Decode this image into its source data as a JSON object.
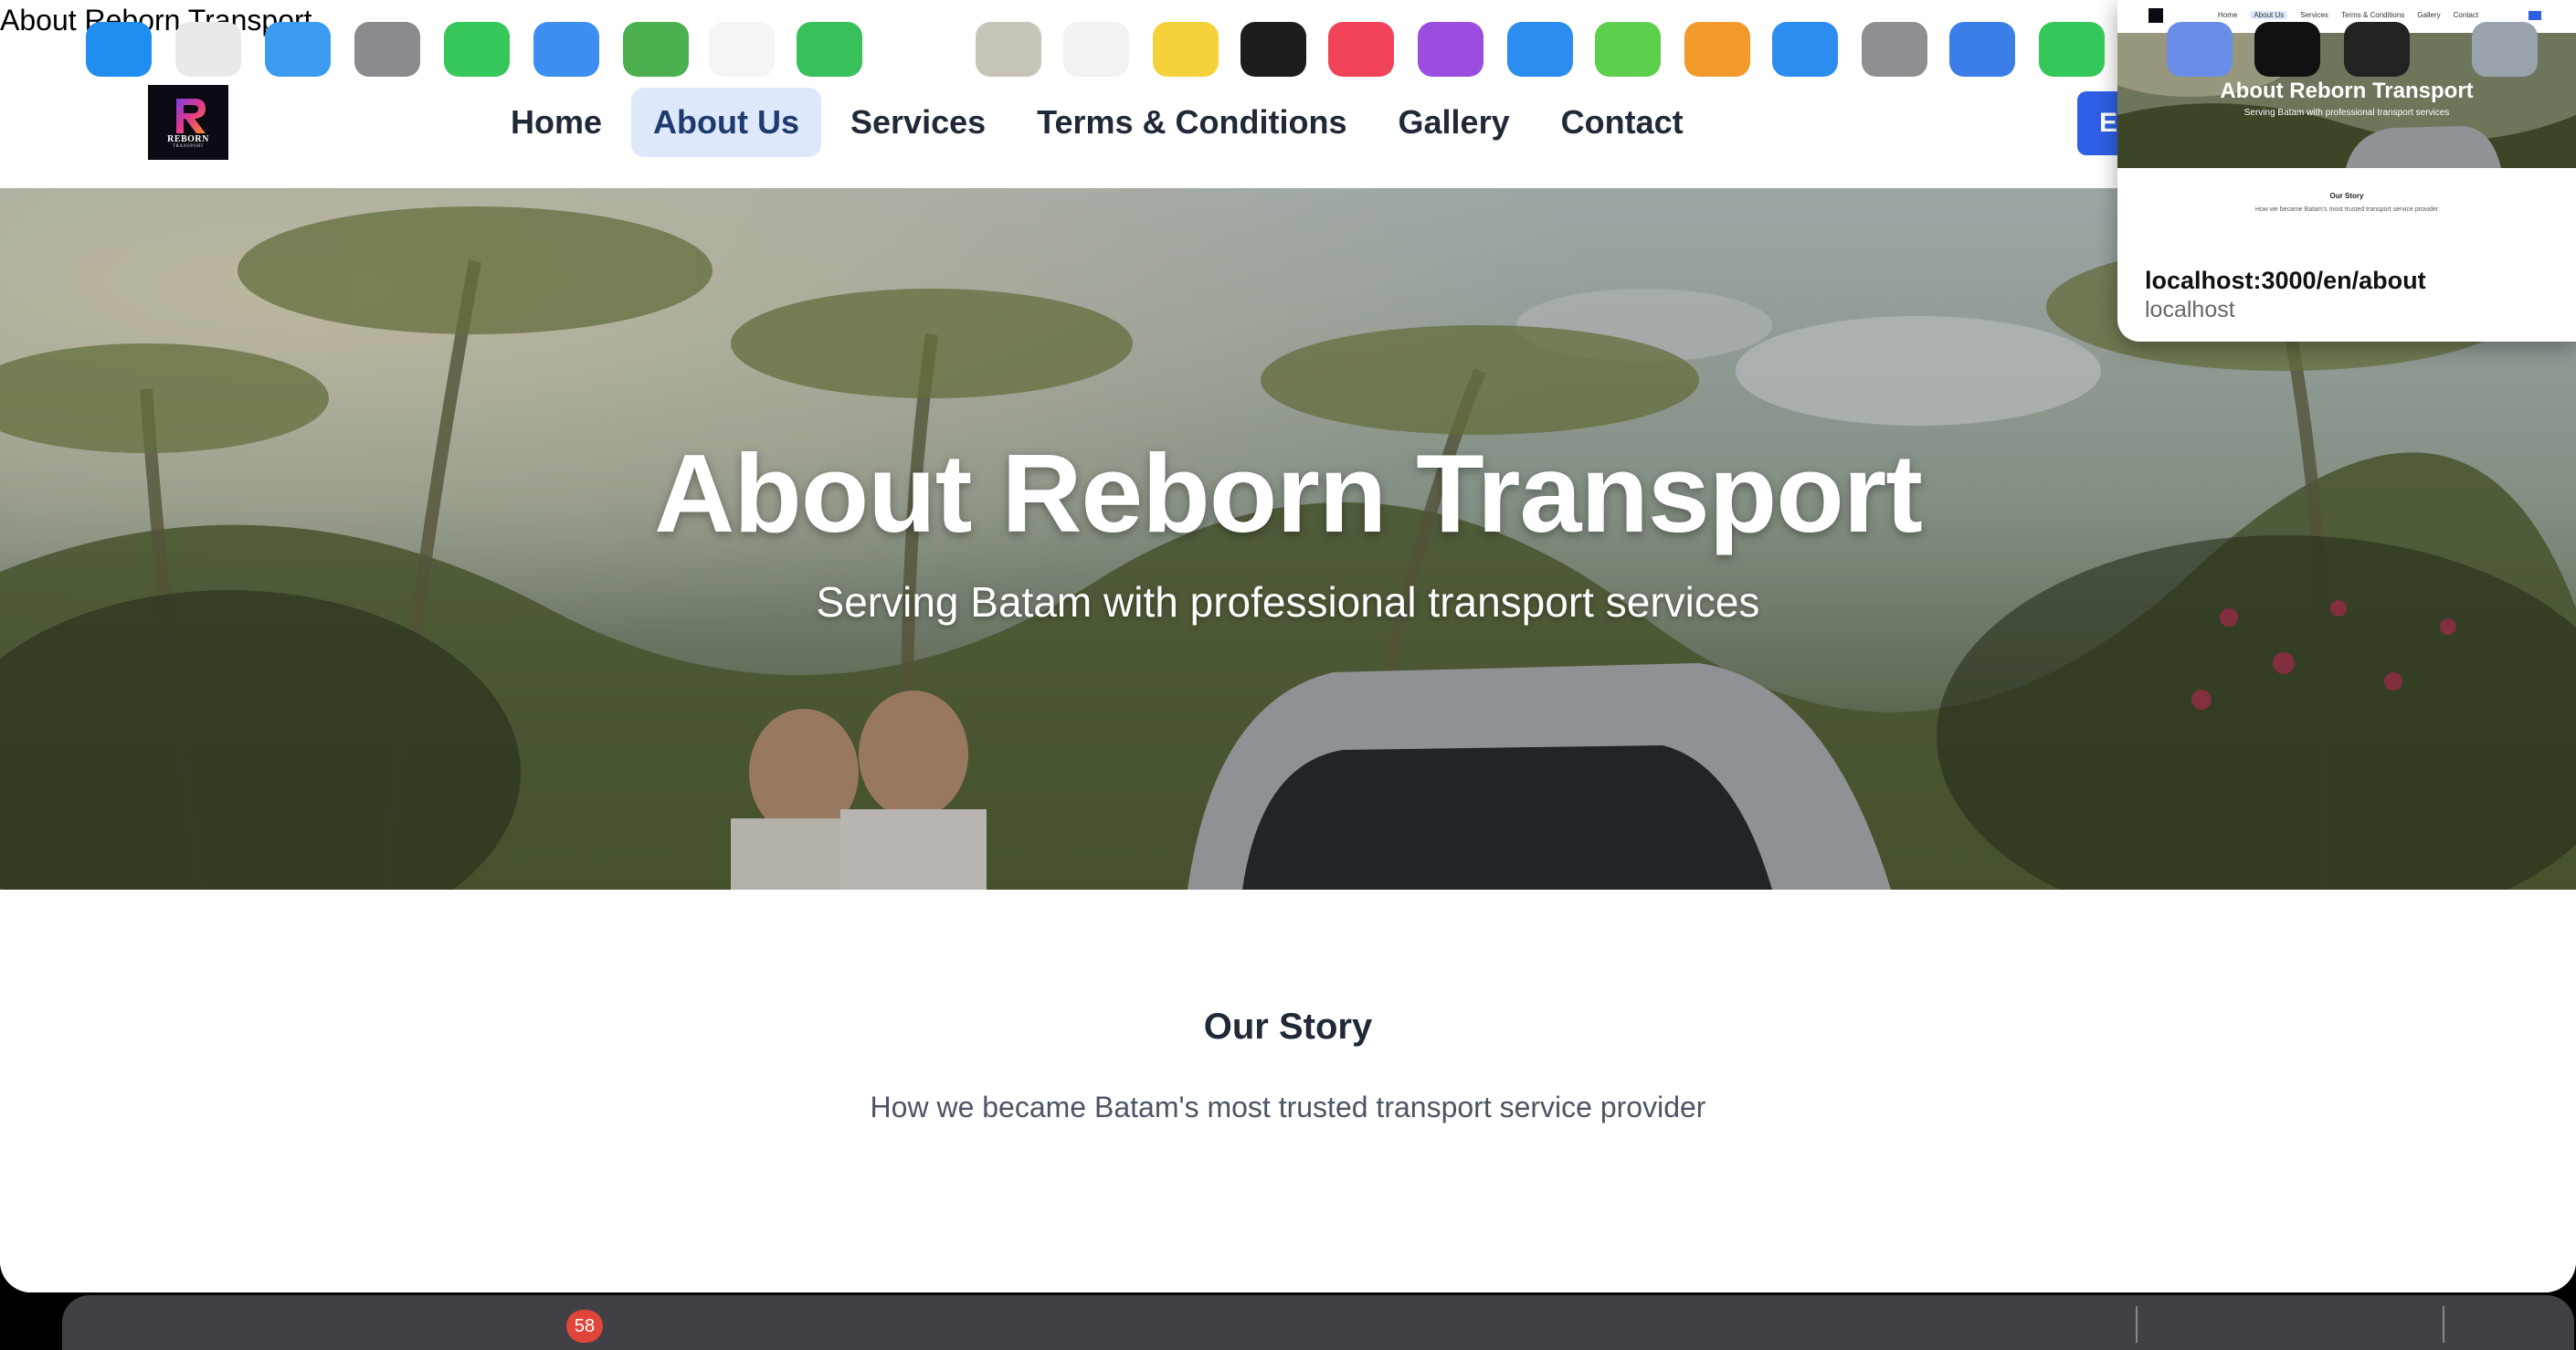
{
  "window": {
    "title": "About Reborn Transport"
  },
  "brand": {
    "logo_text": "REBORN",
    "logo_subtext": "TRANSPORT"
  },
  "nav": {
    "items": [
      {
        "label": "Home",
        "active": false
      },
      {
        "label": "About Us",
        "active": true
      },
      {
        "label": "Services",
        "active": false
      },
      {
        "label": "Terms & Conditions",
        "active": false
      },
      {
        "label": "Gallery",
        "active": false
      },
      {
        "label": "Contact",
        "active": false
      }
    ],
    "cta_partial_label": "E"
  },
  "hero": {
    "title": "About Reborn Transport",
    "subtitle": "Serving Batam with professional transport services"
  },
  "story": {
    "title": "Our Story",
    "text": "How we became Batam's most trusted transport service provider"
  },
  "tab_preview": {
    "url": "localhost:3000/en/about",
    "host": "localhost",
    "thumb_nav": [
      "Home",
      "About Us",
      "Services",
      "Terms & Conditions",
      "Gallery",
      "Contact"
    ],
    "thumb_title": "About Reborn Transport",
    "thumb_subtitle": "Serving Batam with professional transport services",
    "thumb_story_title": "Our Story",
    "thumb_story_text": "How we became Batam's most trusted transport service provider"
  },
  "dock": {
    "mail_badge": "58"
  },
  "colors": {
    "accent": "#2f5fe6",
    "active_nav_bg": "#dde8fb",
    "text_dark": "#1f2937",
    "text_muted": "#4b5563"
  }
}
